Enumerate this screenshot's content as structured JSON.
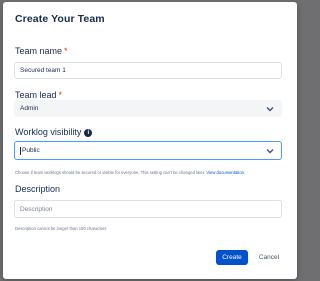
{
  "dialog": {
    "title": "Create Your Team"
  },
  "team_name": {
    "label": "Team name",
    "required_mark": "*",
    "value": "Secured team 1"
  },
  "team_lead": {
    "label": "Team lead",
    "required_mark": "*",
    "value": "Admin"
  },
  "worklog_visibility": {
    "label": "Worklog visibility",
    "info_icon": "info-icon",
    "value": "Public",
    "helper_text": "Choose if team worklogs should be secured or visible for everyone. This setting can't be changed later.",
    "helper_link": "View documentation."
  },
  "description": {
    "label": "Description",
    "placeholder": "Description",
    "helper_text": "Description cannot be longer than 150 characters"
  },
  "actions": {
    "create_label": "Create",
    "cancel_label": "Cancel"
  },
  "colors": {
    "primary": "#0052cc",
    "required": "#de350b",
    "focus_border": "#4c9aff",
    "backdrop": "#6f6f71"
  }
}
